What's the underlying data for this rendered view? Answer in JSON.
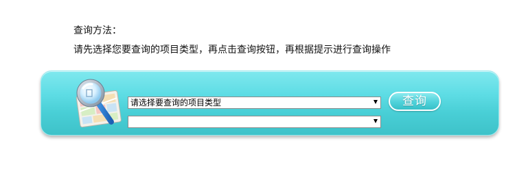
{
  "instructions": {
    "title": "查询方法：",
    "text": "请先选择您要查询的项目类型，再点击查询按钮，再根据提示进行查询操作"
  },
  "search_panel": {
    "type_select": {
      "selected": "请选择要查询的项目类型"
    },
    "item_select": {
      "selected": ""
    },
    "query_button_label": "查询"
  },
  "icons": {
    "logo": "magnifier-over-map-icon",
    "dropdown": "dropdown-arrow-icon"
  },
  "colors": {
    "panel_top": "#7fe8ee",
    "panel_bottom": "#3ec2c9",
    "button_border": "#ffffff"
  }
}
